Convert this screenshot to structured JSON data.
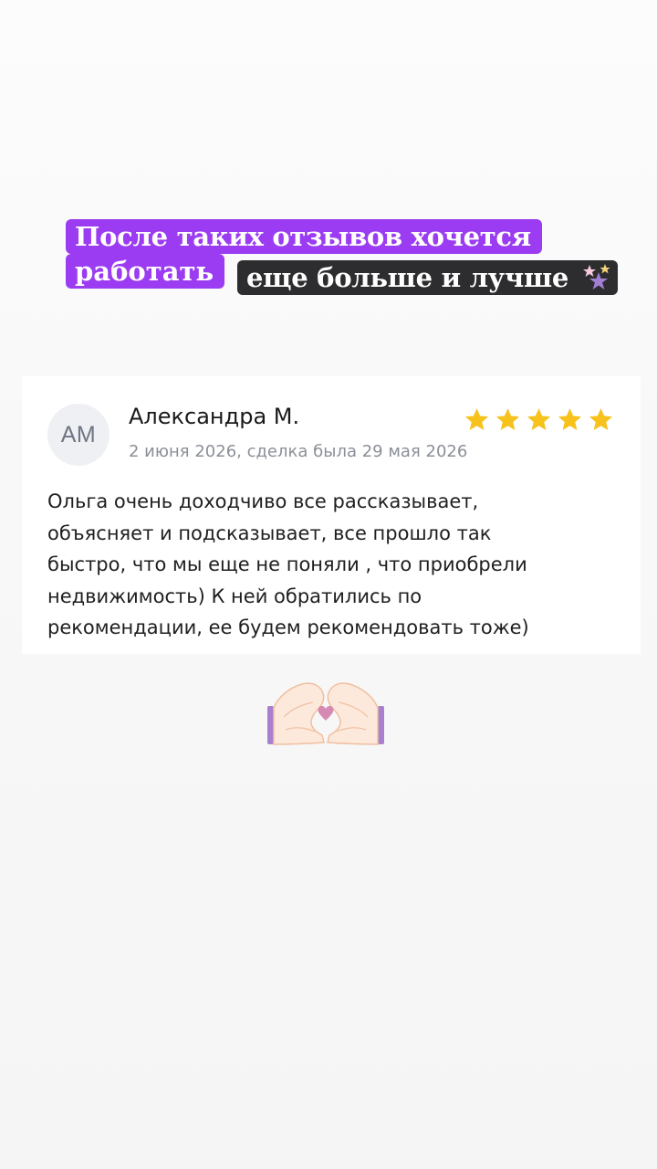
{
  "headline": {
    "line1": "После таких отзывов хочется",
    "line2_purple": "работать",
    "line2_dark": "еще больше и лучше"
  },
  "review": {
    "avatar_initials": "АМ",
    "author": "Александра М.",
    "date": "2 июня 2026, сделка была 29 мая 2026",
    "rating": 5,
    "rating_max": 5,
    "text": "Ольга очень доходчиво все рассказывает,\nобъясняет и подсказывает, все прошло так\nбыстро, что мы еще не поняли , что приобрели\nнедвижимость) К ней обратились по\nрекомендации, ее будем рекомендовать тоже)"
  },
  "icons": {
    "sparkle": "sparkles-icon",
    "star": "star-icon",
    "hands": "heart-hands-icon"
  },
  "colors": {
    "highlight_purple": "#9b3cf2",
    "highlight_dark": "#2d2d2f",
    "star": "#f7c21c",
    "avatar_bg": "#eff0f3"
  }
}
